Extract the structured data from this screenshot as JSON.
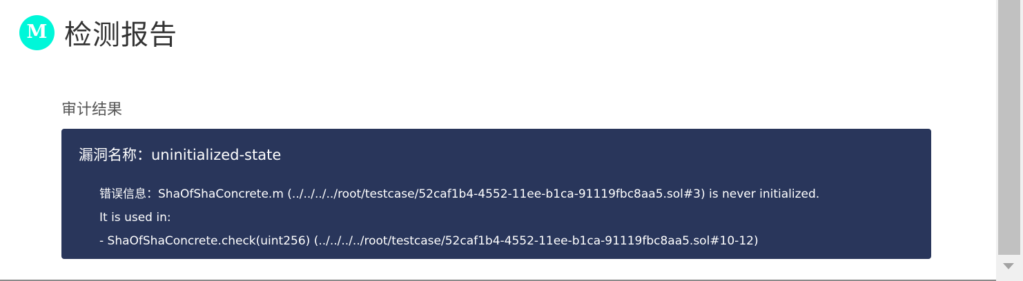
{
  "header": {
    "logo_letter": "M",
    "title": "检测报告"
  },
  "section": {
    "title": "审计结果"
  },
  "vulnerability": {
    "name_label": "漏洞名称：uninitialized-state",
    "detail_lines": [
      "错误信息：ShaOfShaConcrete.m (../../../../root/testcase/52caf1b4-4552-11ee-b1ca-91119fbc8aa5.sol#3) is never initialized.",
      "It is used in:",
      "- ShaOfShaConcrete.check(uint256) (../../../../root/testcase/52caf1b4-4552-11ee-b1ca-91119fbc8aa5.sol#10-12)"
    ]
  },
  "colors": {
    "logo_bg": "#00f7d9",
    "card_bg": "#29365b",
    "title_text": "#333333"
  }
}
